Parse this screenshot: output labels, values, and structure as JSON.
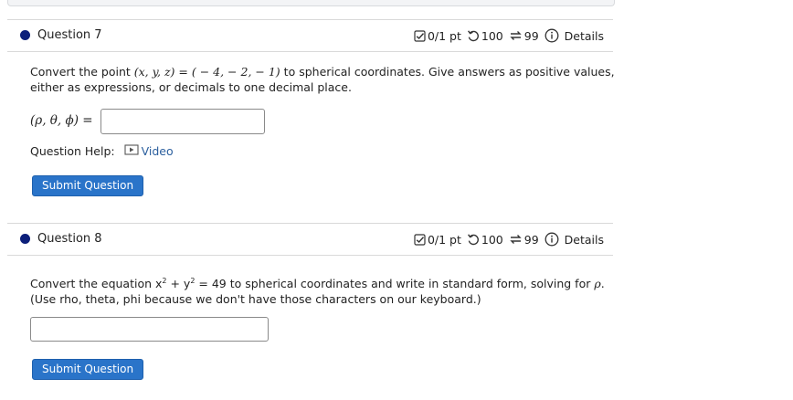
{
  "questions": [
    {
      "title": "Question 7",
      "score": "0/1 pt",
      "attempts": "100",
      "tries": "99",
      "details": "Details",
      "text_before": "Convert the point",
      "text_math": "(x, y, z) = ( − 4, − 2, − 1)",
      "text_after": "to spherical coordinates. Give answers as positive values,",
      "text_line2": "either as expressions, or decimals to one decimal place.",
      "answer_label": "(ρ, θ, ϕ) =",
      "answer_value": "",
      "help_label": "Question Help:",
      "help_link": "Video",
      "submit_label": "Submit Question"
    },
    {
      "title": "Question 8",
      "score": "0/1 pt",
      "attempts": "100",
      "tries": "99",
      "details": "Details",
      "line1_a": "Convert the equation x",
      "sup1": "2",
      "line1_b": " + y",
      "sup2": "2",
      "line1_c": " = 49 to spherical coordinates and write in standard form, solving for",
      "rho": "ρ",
      "line1_end": ".",
      "line2": "(Use rho, theta, phi because we don't have those characters on our keyboard.)",
      "answer_value": "",
      "submit_label": "Submit Question"
    }
  ],
  "colors": {
    "accent_button": "#2a74c9",
    "bullet": "#0c1f7a",
    "link": "#2b5f9e"
  },
  "icons": [
    "checkbox-check-icon",
    "undo-icon",
    "retry-arrows-icon",
    "info-icon",
    "video-icon"
  ]
}
